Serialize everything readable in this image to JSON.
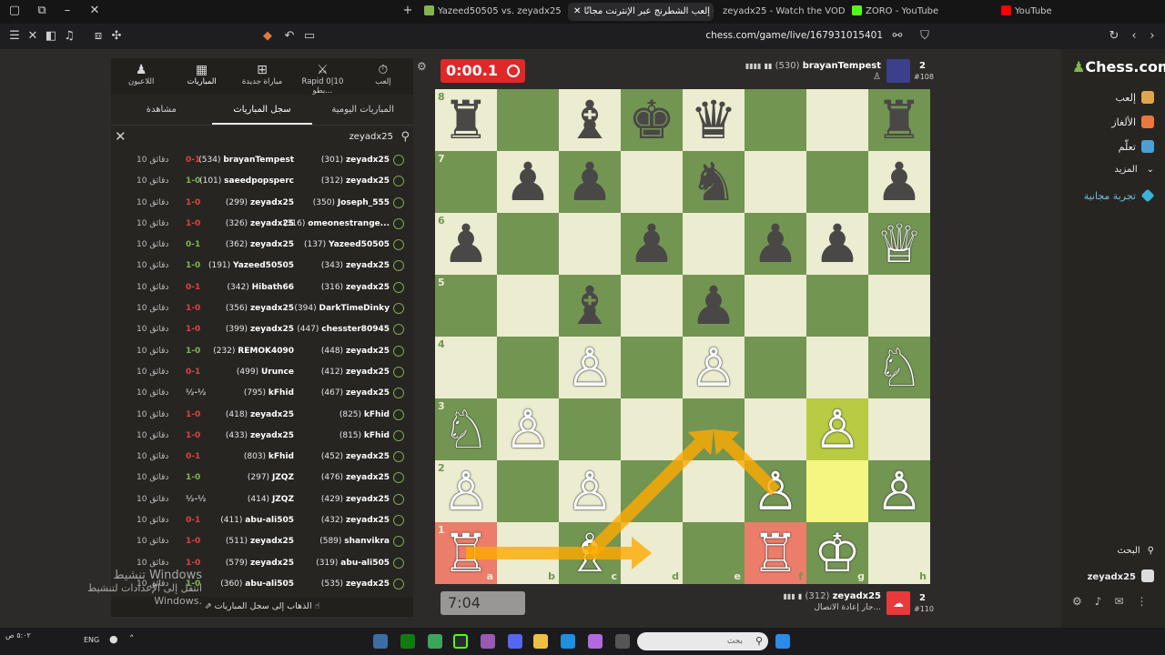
{
  "tabs": [
    {
      "label": "",
      "x_icon": "plus-icon"
    },
    {
      "label": "Yazeed50505 vs. zeyadx25 | Analysis",
      "color": "#81b64c"
    },
    {
      "label": "إلعب الشطرنج عبر الإنترنت مجانًا -",
      "color": "#81b64c",
      "active": true
    },
    {
      "label": "zeyadx25 - Watch the VOD on Kick",
      "color": "#53fc18"
    },
    {
      "label": "ZORO - YouTube",
      "color": "#ff0000"
    },
    {
      "label": "YouTube",
      "color": "#ff0000"
    }
  ],
  "url": "chess.com/game/live/167931015401",
  "left_nav": [
    {
      "label": "إلعب",
      "icon": "stopwatch-icon"
    },
    {
      "label": "Rapid 0|10 بطو...",
      "icon": "tournament-icon"
    },
    {
      "label": "مباراة جديدة",
      "icon": "plus-square-icon"
    },
    {
      "label": "المباريات",
      "icon": "board-icon"
    },
    {
      "label": "اللاعبون",
      "icon": "players-icon"
    }
  ],
  "sub_tabs": [
    "المباريات اليومية",
    "سجل المباريات",
    "مشاهدة"
  ],
  "search_value": "zeyadx25",
  "games": [
    {
      "p1": "zeyadx25",
      "r1": "(301)",
      "p2": "brayanTempest",
      "r2": "(534)",
      "result": "0-1",
      "rtype": "loss",
      "time": "10 دقائق"
    },
    {
      "p1": "zeyadx25",
      "r1": "(312)",
      "p2": "saeedpopsperc",
      "r2": "(101)",
      "result": "1-0",
      "rtype": "win",
      "time": "10 دقائق"
    },
    {
      "p1": "Joseph_555",
      "r1": "(350)",
      "p2": "zeyadx25",
      "r2": "(299)",
      "result": "1-0",
      "rtype": "loss",
      "time": "10 دقائق"
    },
    {
      "p1": "omeonestrange...",
      "r1": "(316)",
      "p2": "zeyadx25",
      "r2": "(326)",
      "result": "1-0",
      "rtype": "loss",
      "time": "10 دقائق"
    },
    {
      "p1": "Yazeed50505",
      "r1": "(137)",
      "p2": "zeyadx25",
      "r2": "(362)",
      "result": "0-1",
      "rtype": "win",
      "time": "10 دقائق"
    },
    {
      "p1": "zeyadx25",
      "r1": "(343)",
      "p2": "Yazeed50505",
      "r2": "(191)",
      "result": "1-0",
      "rtype": "win",
      "time": "10 دقائق"
    },
    {
      "p1": "zeyadx25",
      "r1": "(316)",
      "p2": "Hibath66",
      "r2": "(342)",
      "result": "0-1",
      "rtype": "loss",
      "time": "10 دقائق"
    },
    {
      "p1": "DarkTimeDinky",
      "r1": "(394)",
      "p2": "zeyadx25",
      "r2": "(356)",
      "result": "1-0",
      "rtype": "loss",
      "time": "10 دقائق"
    },
    {
      "p1": "chesster80945",
      "r1": "(447)",
      "p2": "zeyadx25",
      "r2": "(399)",
      "result": "1-0",
      "rtype": "loss",
      "time": "10 دقائق"
    },
    {
      "p1": "zeyadx25",
      "r1": "(448)",
      "p2": "REMOK4090",
      "r2": "(232)",
      "result": "1-0",
      "rtype": "win",
      "time": "10 دقائق"
    },
    {
      "p1": "zeyadx25",
      "r1": "(412)",
      "p2": "Urunce",
      "r2": "(499)",
      "result": "0-1",
      "rtype": "loss",
      "time": "10 دقائق"
    },
    {
      "p1": "zeyadx25",
      "r1": "(467)",
      "p2": "kFhid",
      "r2": "(795)",
      "result": "½-½",
      "rtype": "draw",
      "time": "10 دقائق"
    },
    {
      "p1": "kFhid",
      "r1": "(825)",
      "p2": "zeyadx25",
      "r2": "(418)",
      "result": "1-0",
      "rtype": "loss",
      "time": "10 دقائق"
    },
    {
      "p1": "kFhid",
      "r1": "(815)",
      "p2": "zeyadx25",
      "r2": "(433)",
      "result": "1-0",
      "rtype": "loss",
      "time": "10 دقائق"
    },
    {
      "p1": "zeyadx25",
      "r1": "(452)",
      "p2": "kFhid",
      "r2": "(803)",
      "result": "0-1",
      "rtype": "loss",
      "time": "10 دقائق"
    },
    {
      "p1": "zeyadx25",
      "r1": "(476)",
      "p2": "JZQZ",
      "r2": "(297)",
      "result": "1-0",
      "rtype": "win",
      "time": "10 دقائق"
    },
    {
      "p1": "zeyadx25",
      "r1": "(429)",
      "p2": "JZQZ",
      "r2": "(414)",
      "result": "½-½",
      "rtype": "draw",
      "time": "10 دقائق"
    },
    {
      "p1": "zeyadx25",
      "r1": "(432)",
      "p2": "abu-ali505",
      "r2": "(411)",
      "result": "0-1",
      "rtype": "loss",
      "time": "10 دقائق"
    },
    {
      "p1": "shanvikra",
      "r1": "(589)",
      "p2": "zeyadx25",
      "r2": "(511)",
      "result": "1-0",
      "rtype": "loss",
      "time": "10 دقائق"
    },
    {
      "p1": "abu-ali505",
      "r1": "(319)",
      "p2": "zeyadx25",
      "r2": "(579)",
      "result": "1-0",
      "rtype": "loss",
      "time": "10 دقائق"
    },
    {
      "p1": "zeyadx25",
      "r1": "(535)",
      "p2": "abu-ali505",
      "r2": "(360)",
      "result": "1-0",
      "rtype": "win",
      "time": "10 دقائق"
    }
  ],
  "footer_link": "الذهاب إلى سجل المباريات",
  "watermark": {
    "line1": "تنشيط Windows",
    "line2": "انتقل إلى الإعدادات لتنشيط Windows."
  },
  "top_player": {
    "name": "brayanTempest",
    "rating": "(530)",
    "points": "2",
    "rank": "#108",
    "clock": "0:00.1",
    "signal": "▮▮▮▮"
  },
  "bottom_player": {
    "name": "zeyadx25",
    "rating": "(312)",
    "points": "2",
    "rank": "#110",
    "clock": "7:04",
    "status": "جار إعادة الاتصال...",
    "signal": "▮▮▮"
  },
  "board": {
    "ranks": [
      "8",
      "7",
      "6",
      "5",
      "4",
      "3",
      "2",
      "1"
    ],
    "files": [
      "a",
      "b",
      "c",
      "d",
      "e",
      "f",
      "g",
      "h"
    ],
    "pieces": {
      "a8": "br",
      "c8": "bb",
      "d8": "bk",
      "e8": "bq",
      "h8": "br",
      "b7": "bp",
      "c7": "bp",
      "e7": "bn",
      "h7": "bp",
      "a6": "bp",
      "d6": "bp",
      "f6": "bp",
      "g6": "bp",
      "h6": "wq",
      "c5": "bb",
      "e5": "bp",
      "c4": "wp",
      "e4": "wp",
      "h4": "wn",
      "a3": "wn",
      "b3": "wp",
      "g3": "wp",
      "a2": "wp",
      "c2": "wp",
      "f2": "wp",
      "h2": "wp",
      "a1": "wr",
      "c1": "wb",
      "f1": "wr",
      "g1": "wk"
    },
    "highlights": {
      "g3": "hl-yellow2",
      "g2": "hl-yellow",
      "a1": "hl-red",
      "f1": "hl-red"
    },
    "arrows": [
      [
        "a1",
        "d1"
      ],
      [
        "c1",
        "e3"
      ],
      [
        "f2",
        "e3"
      ]
    ]
  },
  "right_nav": [
    {
      "label": "إلعب",
      "color": "#e0a74a",
      "icon": "pawn-icon"
    },
    {
      "label": "الألغاز",
      "color": "#e8783c",
      "icon": "puzzle-icon"
    },
    {
      "label": "تعلّم",
      "color": "#4b9fd5",
      "icon": "cap-icon"
    },
    {
      "label": "المزيد",
      "color": "#888",
      "icon": "chevron-down-icon"
    },
    {
      "label": "تجربة مجانية",
      "color": "#39b3d9",
      "icon": "diamond-icon"
    }
  ],
  "brand": "Chess.com",
  "right_search": "البحث",
  "right_user": "zeyadx25",
  "taskbar": {
    "search_placeholder": "بحث",
    "lang": "ENG"
  }
}
